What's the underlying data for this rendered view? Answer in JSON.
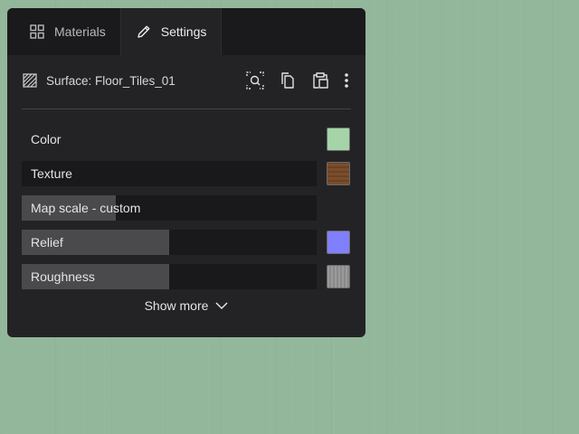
{
  "tabs": [
    {
      "label": "Materials",
      "icon": "grid-icon"
    },
    {
      "label": "Settings",
      "icon": "pencil-icon"
    }
  ],
  "header": {
    "title": "Surface: Floor_Tiles_01",
    "surface_icon": "hatch-icon",
    "tools": [
      "focus-search-icon",
      "copy-icon",
      "paste-icon",
      "more-vertical-icon"
    ]
  },
  "properties": [
    {
      "label": "Color",
      "level": null,
      "swatch": "#a5d4a8"
    },
    {
      "label": "Texture",
      "level": 0,
      "swatch": "texture"
    },
    {
      "label": "Map scale - custom",
      "level": 0.32,
      "swatch": null
    },
    {
      "label": "Relief",
      "level": 0.5,
      "swatch": "#8080ff"
    },
    {
      "label": "Roughness",
      "level": 0.5,
      "swatch": "rough"
    }
  ],
  "show_more": {
    "label": "Show more",
    "icon": "chevron-down-icon"
  },
  "colors": {
    "background": "#93b79b",
    "panel": "#232325",
    "tabbar": "#1a1a1c"
  }
}
